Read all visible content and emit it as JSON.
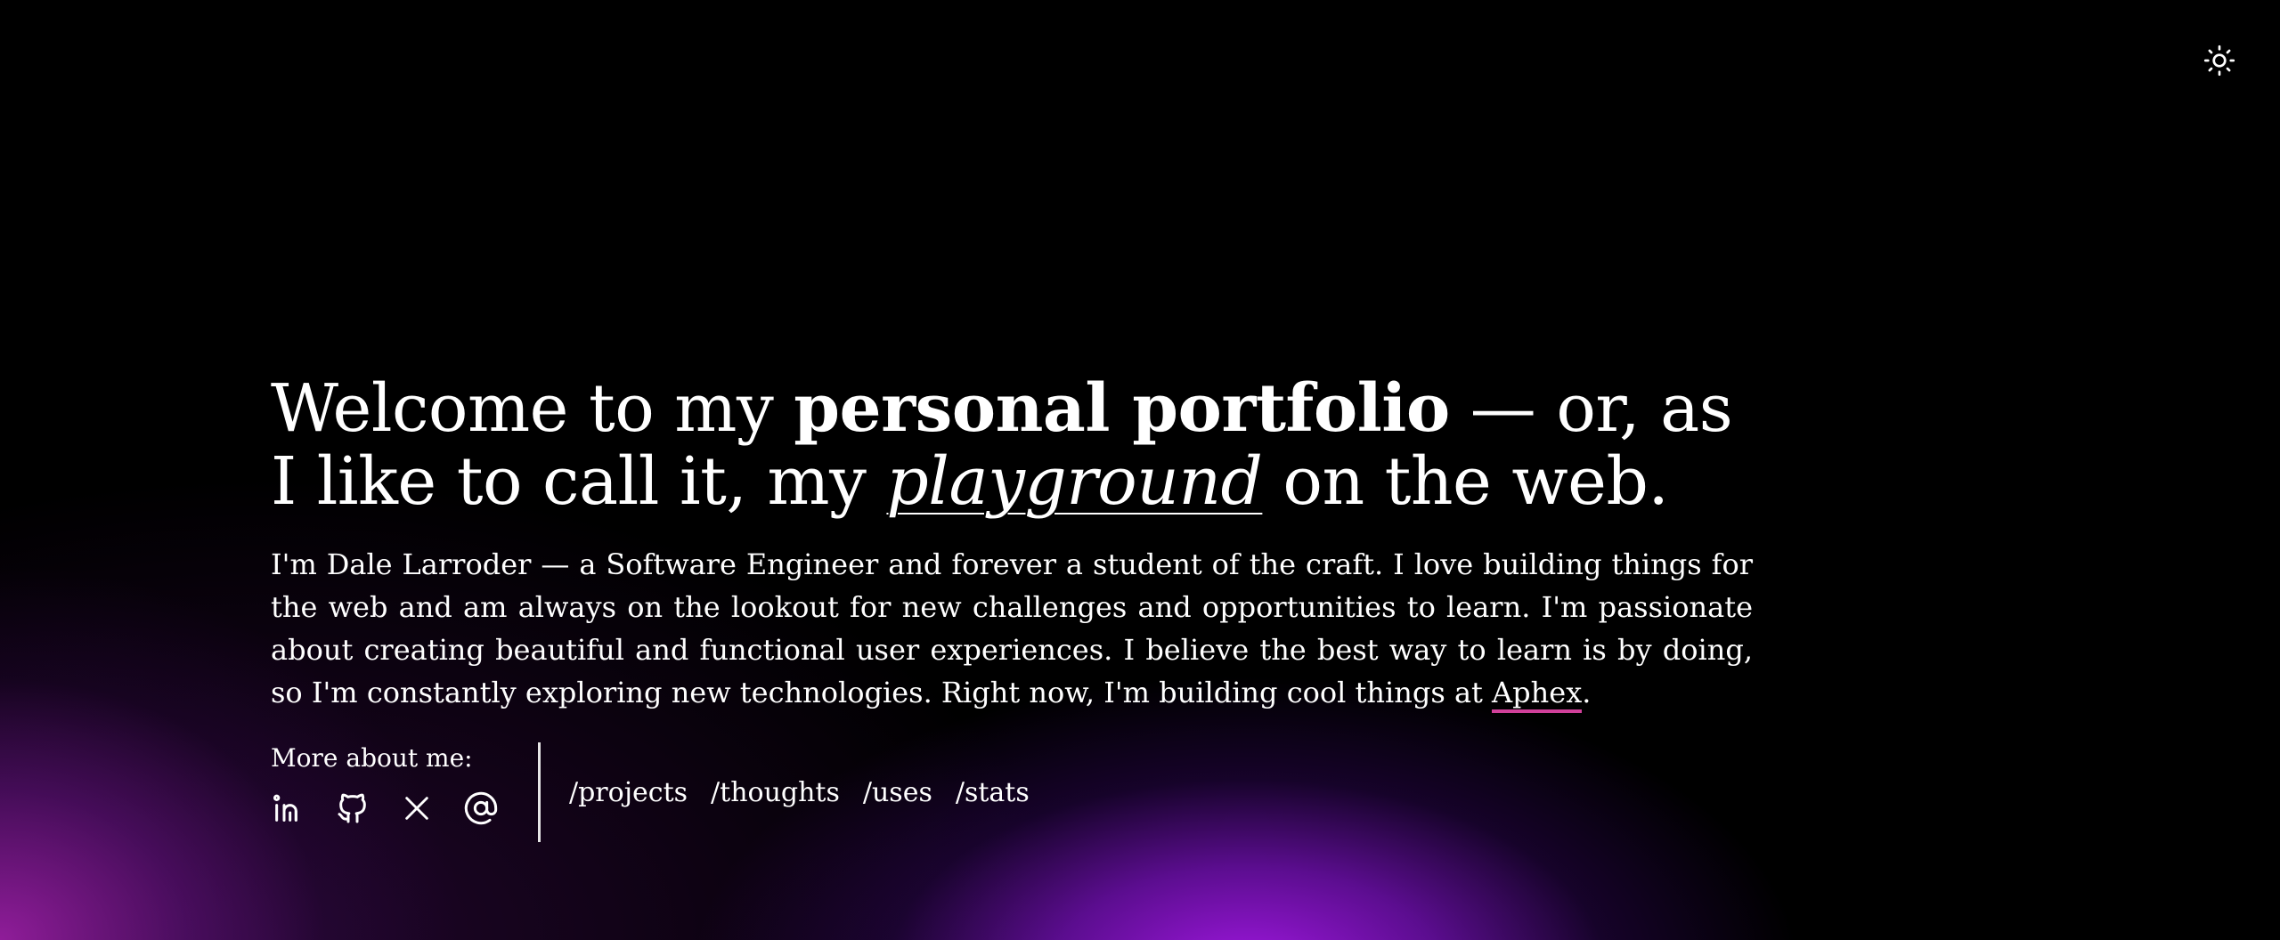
{
  "headline": {
    "part1": "Welcome to my ",
    "bold": "personal portfolio",
    "part2": " — or, as I like to call it, my ",
    "italic": "playground",
    "part3": " on the web."
  },
  "bio": {
    "text": "I'm Dale Larroder — a Software Engineer and forever a student of the craft. I love building things for the web and am always on the lookout for new challenges and opportunities to learn. I'm passionate about creating beautiful and functional user experiences. I believe the best way to learn is by doing, so I'm constantly exploring new technologies. Right now, I'm building cool things at ",
    "link_label": "Aphex",
    "end": "."
  },
  "more_about": {
    "label": "More about me:",
    "socials": [
      {
        "name": "linkedin-icon"
      },
      {
        "name": "github-icon"
      },
      {
        "name": "x-icon"
      },
      {
        "name": "email-at-icon"
      }
    ]
  },
  "nav": {
    "items": [
      "/projects",
      "/thoughts",
      "/uses",
      "/stats"
    ]
  },
  "theme_toggle": {
    "icon": "sun-icon"
  },
  "colors": {
    "link_underline": "#d1409a",
    "glow_purple": "#a819eb",
    "glow_magenta": "#961ea0",
    "background": "#000000"
  }
}
